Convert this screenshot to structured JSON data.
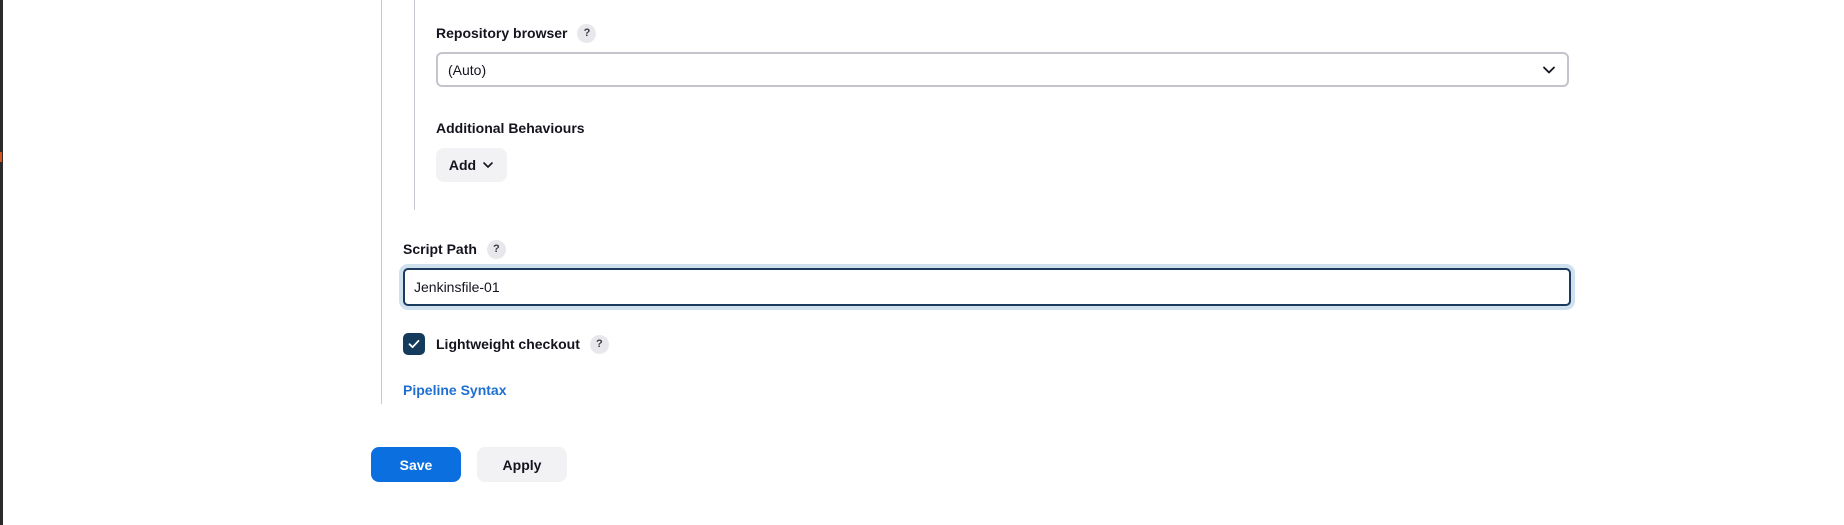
{
  "repository_browser": {
    "label": "Repository browser",
    "help": "?",
    "selected": "(Auto)"
  },
  "additional_behaviours": {
    "label": "Additional Behaviours",
    "add_label": "Add"
  },
  "script_path": {
    "label": "Script Path",
    "help": "?",
    "value": "Jenkinsfile-01"
  },
  "lightweight_checkout": {
    "label": "Lightweight checkout",
    "help": "?",
    "checked": true
  },
  "pipeline_syntax": {
    "label": "Pipeline Syntax"
  },
  "actions": {
    "save_label": "Save",
    "apply_label": "Apply"
  },
  "colors": {
    "primary": "#0b6fe0",
    "link": "#1f6fd1",
    "checkbox": "#143b5c",
    "focus_ring": "#cfe0ef"
  },
  "icons": {
    "dropdown": "chevron-down-icon",
    "add": "chevron-down-icon",
    "checkbox": "check-icon"
  }
}
